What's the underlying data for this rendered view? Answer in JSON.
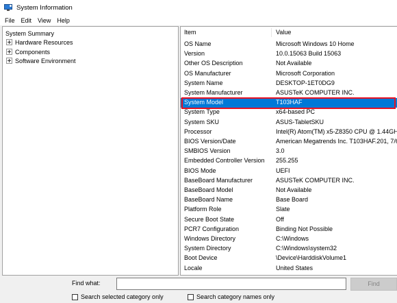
{
  "window": {
    "title": "System Information"
  },
  "menu": [
    "File",
    "Edit",
    "View",
    "Help"
  ],
  "tree": {
    "root": "System Summary",
    "children": [
      "Hardware Resources",
      "Components",
      "Software Environment"
    ]
  },
  "list": {
    "columns": {
      "item": "Item",
      "value": "Value"
    },
    "selected_index": 6,
    "rows": [
      {
        "item": "OS Name",
        "value": "Microsoft Windows 10 Home"
      },
      {
        "item": "Version",
        "value": "10.0.15063 Build 15063"
      },
      {
        "item": "Other OS Description",
        "value": "Not Available"
      },
      {
        "item": "OS Manufacturer",
        "value": "Microsoft Corporation"
      },
      {
        "item": "System Name",
        "value": "DESKTOP-1ET0DG9"
      },
      {
        "item": "System Manufacturer",
        "value": "ASUSTeK COMPUTER INC."
      },
      {
        "item": "System Model",
        "value": "T103HAF"
      },
      {
        "item": "System Type",
        "value": "x64-based PC"
      },
      {
        "item": "System SKU",
        "value": "ASUS-TabletSKU"
      },
      {
        "item": "Processor",
        "value": "Intel(R) Atom(TM) x5-Z8350  CPU @ 1.44GHz,"
      },
      {
        "item": "BIOS Version/Date",
        "value": "American Megatrends Inc. T103HAF.201, 7/6/"
      },
      {
        "item": "SMBIOS Version",
        "value": "3.0"
      },
      {
        "item": "Embedded Controller Version",
        "value": "255.255"
      },
      {
        "item": "BIOS Mode",
        "value": "UEFI"
      },
      {
        "item": "BaseBoard Manufacturer",
        "value": "ASUSTeK COMPUTER INC."
      },
      {
        "item": "BaseBoard Model",
        "value": "Not Available"
      },
      {
        "item": "BaseBoard Name",
        "value": "Base Board"
      },
      {
        "item": "Platform Role",
        "value": "Slate"
      },
      {
        "item": "Secure Boot State",
        "value": "Off"
      },
      {
        "item": "PCR7 Configuration",
        "value": "Binding Not Possible"
      },
      {
        "item": "Windows Directory",
        "value": "C:\\Windows"
      },
      {
        "item": "System Directory",
        "value": "C:\\Windows\\system32"
      },
      {
        "item": "Boot Device",
        "value": "\\Device\\HarddiskVolume1"
      },
      {
        "item": "Locale",
        "value": "United States"
      }
    ]
  },
  "find": {
    "label": "Find what:",
    "value": "",
    "button": "Find",
    "search_selected_label": "Search selected category only",
    "search_names_label": "Search category names only"
  },
  "colors": {
    "selection": "#0078d7",
    "highlight_border": "#e81123"
  }
}
